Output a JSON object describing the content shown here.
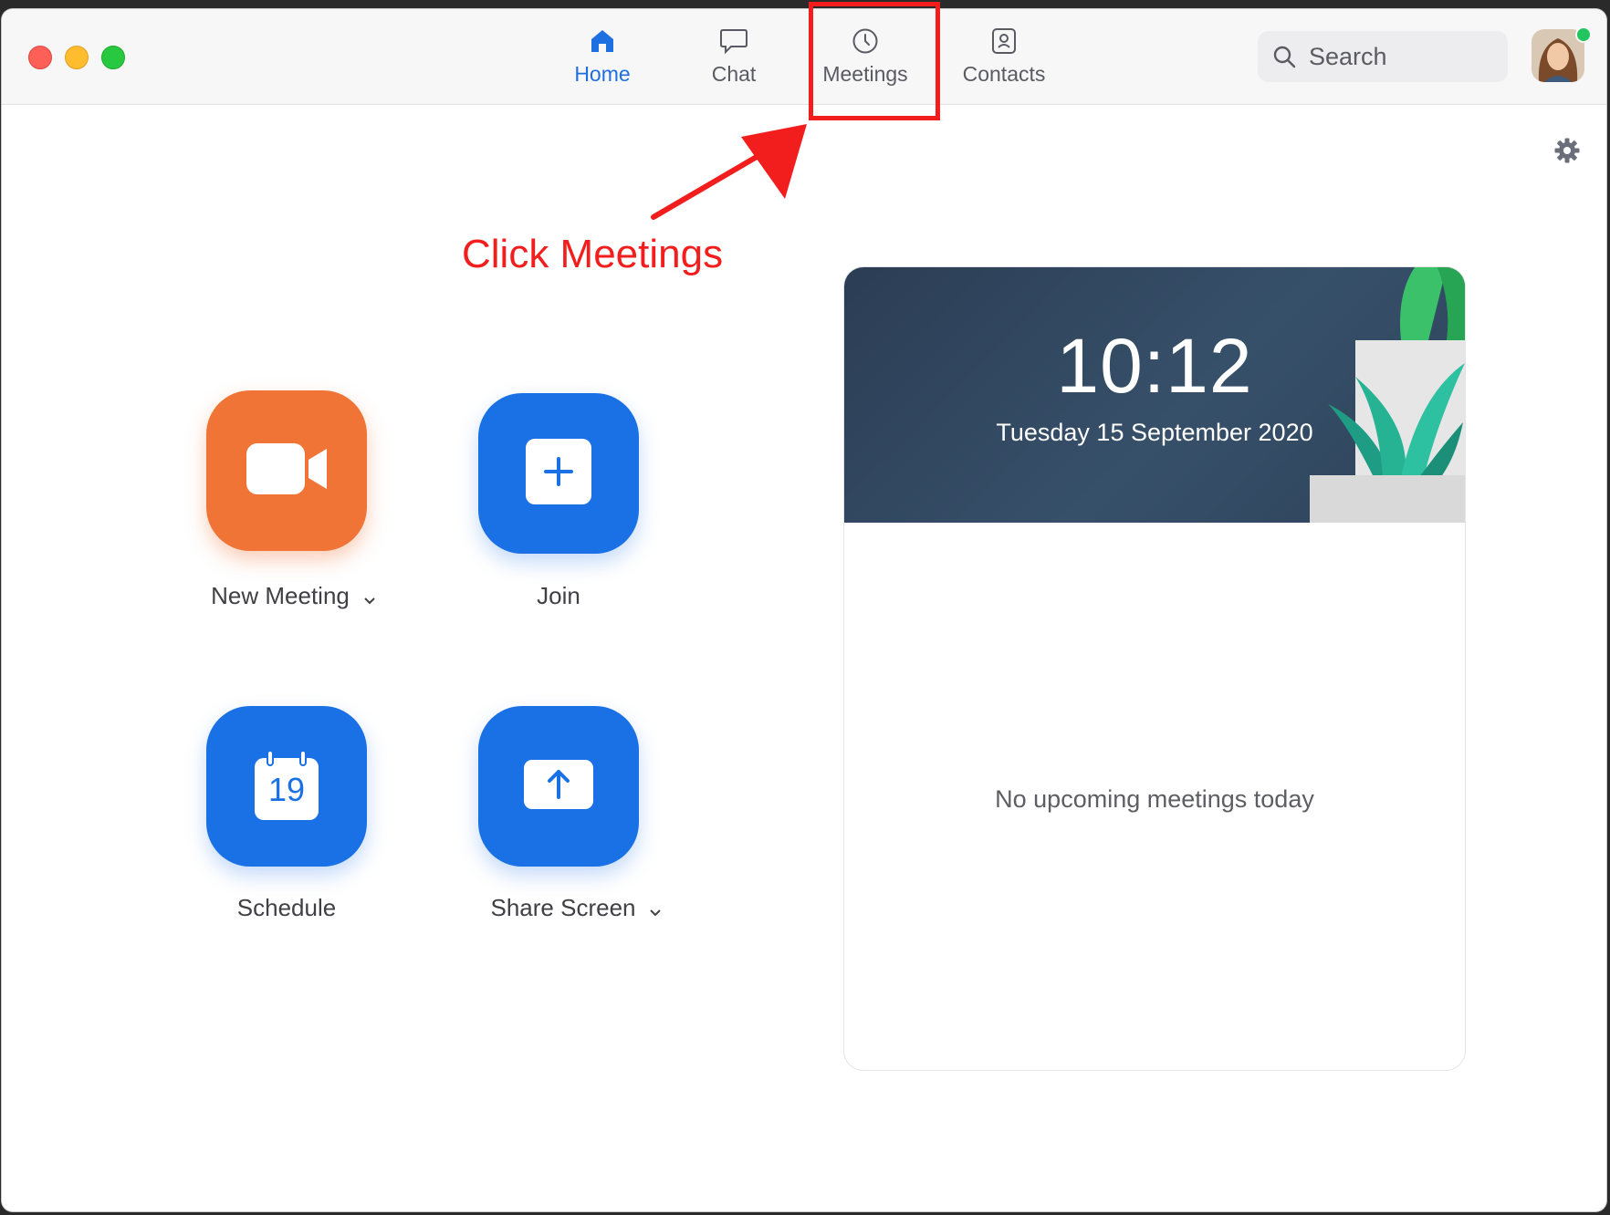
{
  "nav": {
    "tabs": [
      {
        "label": "Home",
        "icon": "home-icon",
        "active": true
      },
      {
        "label": "Chat",
        "icon": "chat-icon",
        "active": false
      },
      {
        "label": "Meetings",
        "icon": "clock-icon",
        "active": false
      },
      {
        "label": "Contacts",
        "icon": "contacts-icon",
        "active": false
      }
    ],
    "accent_color": "#1e6fe0"
  },
  "search": {
    "placeholder": "Search"
  },
  "annotation": {
    "text": "Click Meetings",
    "color": "#f21d1d"
  },
  "actions": {
    "new_meeting": {
      "label": "New Meeting",
      "icon": "video-camera-icon",
      "color": "#f07436"
    },
    "join": {
      "label": "Join",
      "icon": "plus-icon",
      "color": "#1a71e6"
    },
    "schedule": {
      "label": "Schedule",
      "icon": "calendar-icon",
      "calendar_day": "19",
      "color": "#1a71e6"
    },
    "share_screen": {
      "label": "Share Screen",
      "icon": "share-up-arrow-icon",
      "color": "#1a71e6"
    }
  },
  "card": {
    "time": "10:12",
    "date": "Tuesday 15 September 2020",
    "empty_message": "No upcoming meetings today"
  }
}
